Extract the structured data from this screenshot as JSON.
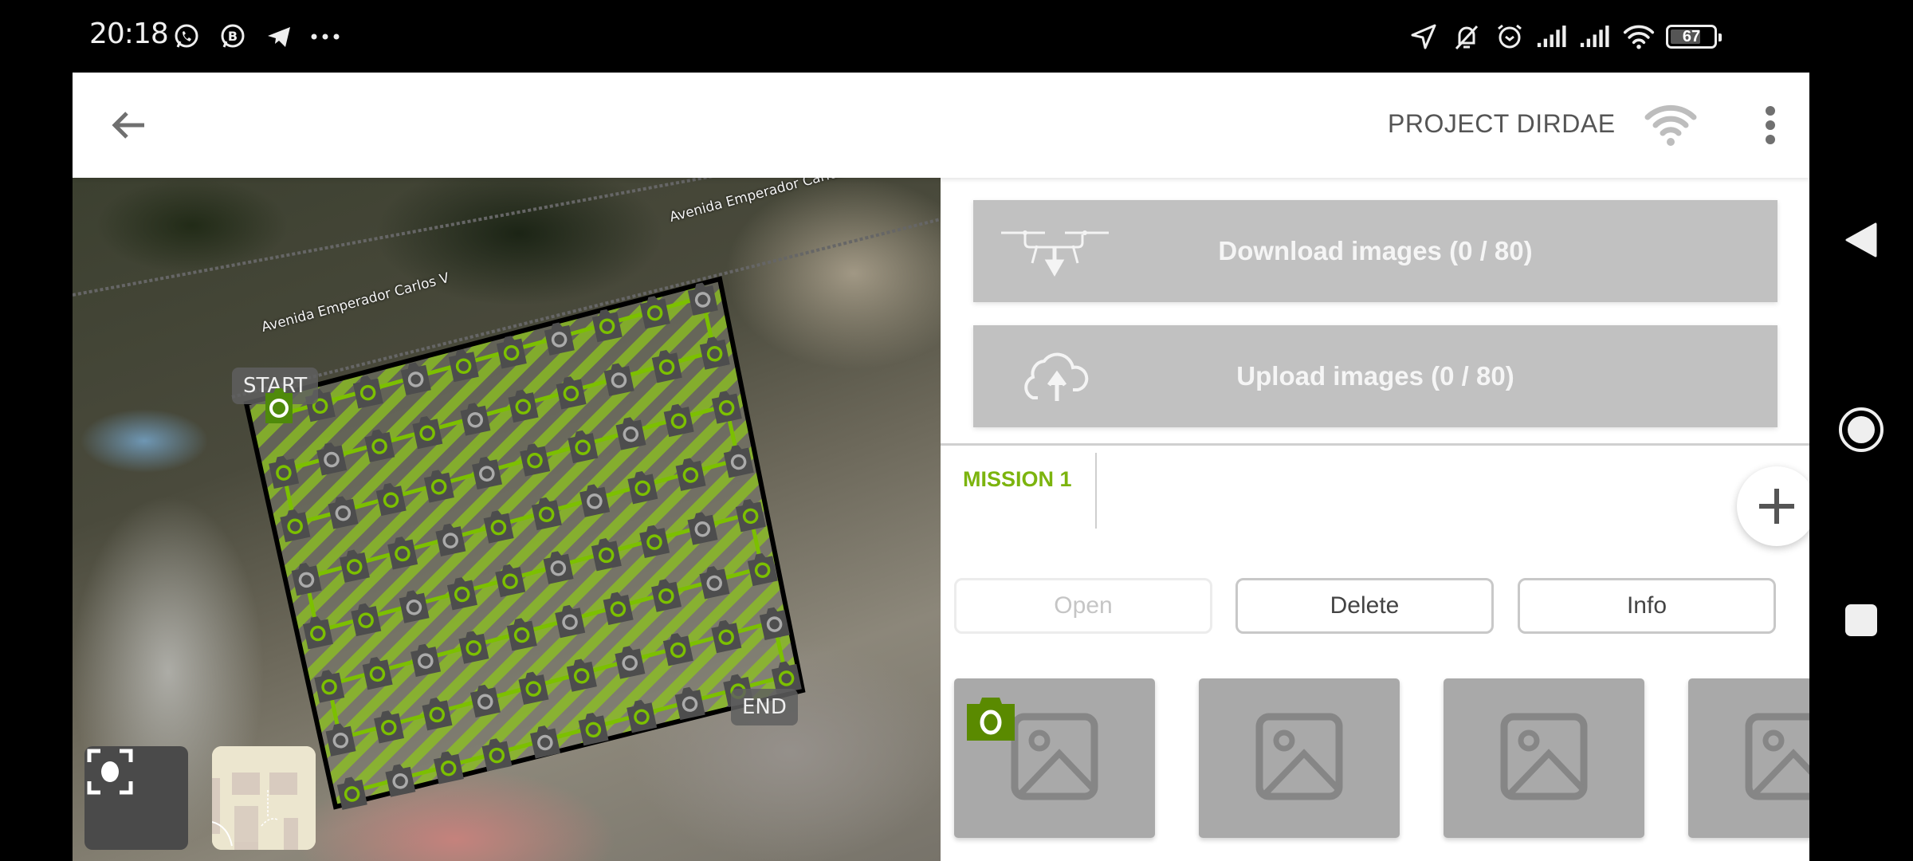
{
  "status_bar": {
    "time": "20:18",
    "left_icons": [
      "whatsapp-icon",
      "whatsapp-business-icon",
      "telegram-icon",
      "more-notifications-icon"
    ],
    "right_icons": [
      "location-icon",
      "bell-muted-icon",
      "alarm-icon",
      "signal-sim1-icon",
      "signal-sim2-icon",
      "wifi-icon"
    ],
    "battery_level": "67"
  },
  "header": {
    "back_icon": "arrow-back-icon",
    "title": "PROJECT DIRDAE",
    "connection_icon": "wifi-icon",
    "menu_icon": "more-vert-icon"
  },
  "map": {
    "street_labels": [
      "Avenida Emperador Carlos V",
      "Avenida Emperador Carlos V"
    ],
    "start_label": "START",
    "end_label": "END",
    "waypoint_count": 80,
    "colors": {
      "accent": "#7cc000",
      "polygon_stripe": "#8fbf2a",
      "start_marker": "#4f8a0b",
      "waypoint": "#4d4d4d"
    },
    "controls": {
      "locate_icon": "center-focus-icon",
      "layer_icon": "map-layer-thumbnail"
    }
  },
  "panel": {
    "download": {
      "icon": "drone-download-icon",
      "label": "Download images (0 / 80)"
    },
    "upload": {
      "icon": "cloud-upload-icon",
      "label": "Upload images (0 / 80)"
    },
    "tabs": [
      {
        "label": "MISSION 1",
        "active": true
      }
    ],
    "add_icon": "plus-icon",
    "actions": [
      {
        "label": "Open",
        "enabled": false
      },
      {
        "label": "Delete",
        "enabled": true
      },
      {
        "label": "Info",
        "enabled": true
      }
    ],
    "thumbnails": [
      {
        "icon": "image-placeholder-icon",
        "badge": "camera-icon"
      },
      {
        "icon": "image-placeholder-icon"
      },
      {
        "icon": "image-placeholder-icon"
      },
      {
        "icon": "image-placeholder-icon"
      }
    ],
    "accent_color": "#7cb40e"
  },
  "nav_bar": {
    "back_icon": "nav-back-icon",
    "home_icon": "nav-home-icon",
    "recents_icon": "nav-recents-icon"
  }
}
